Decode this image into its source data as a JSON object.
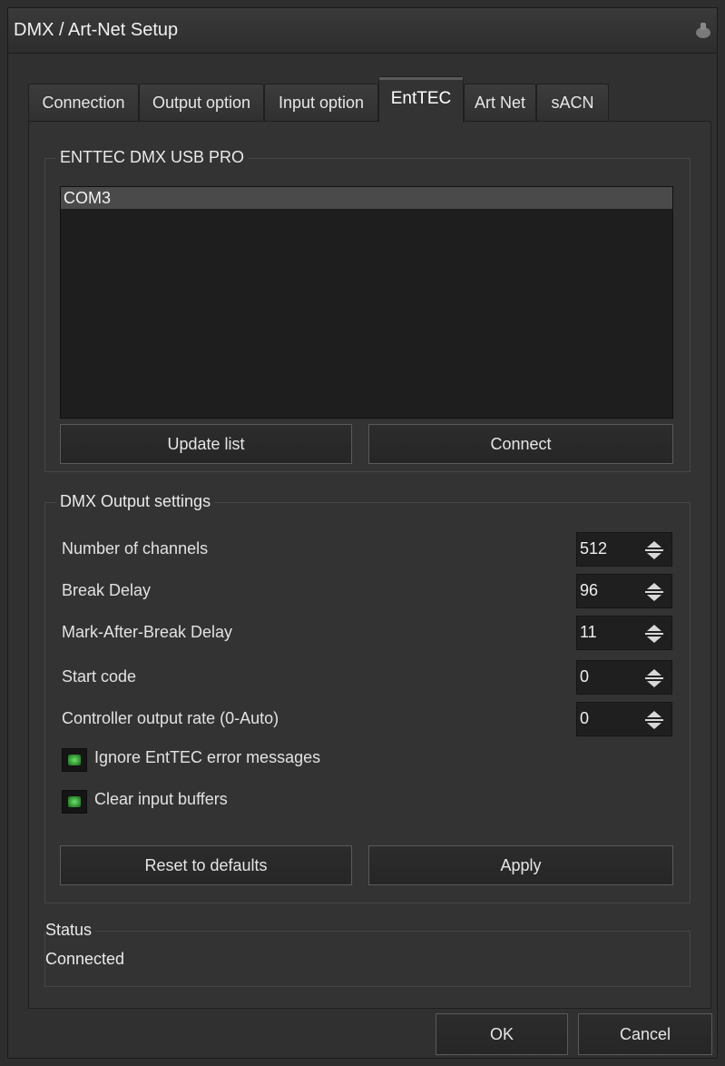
{
  "window": {
    "title": "DMX / Art-Net Setup"
  },
  "tabs": [
    {
      "label": "Connection"
    },
    {
      "label": "Output option"
    },
    {
      "label": "Input option"
    },
    {
      "label": "EntTEC"
    },
    {
      "label": "Art Net"
    },
    {
      "label": "sACN"
    }
  ],
  "active_tab": "EntTEC",
  "device_group": {
    "title": "ENTTEC DMX USB PRO",
    "ports": [
      "COM3"
    ],
    "selected_port": "COM3",
    "update_button": "Update list",
    "connect_button": "Connect"
  },
  "output_group": {
    "title": "DMX Output settings",
    "rows": [
      {
        "label": "Number of channels",
        "value": "512"
      },
      {
        "label": "Break Delay",
        "value": "96"
      },
      {
        "label": "Mark-After-Break Delay",
        "value": "11"
      },
      {
        "label": "Start code",
        "value": "0"
      },
      {
        "label": "Controller output rate (0-Auto)",
        "value": "0"
      }
    ],
    "checkboxes": [
      {
        "label": "Ignore EntTEC error messages",
        "checked": true
      },
      {
        "label": "Clear input buffers",
        "checked": true
      }
    ],
    "reset_button": "Reset to defaults",
    "apply_button": "Apply"
  },
  "status_group": {
    "title": "Status",
    "value": "Connected"
  },
  "footer": {
    "ok_button": "OK",
    "cancel_button": "Cancel"
  },
  "colors": {
    "background": "#303030",
    "led_green": "#4fbf4f",
    "listbox": "#1e1e1e"
  }
}
